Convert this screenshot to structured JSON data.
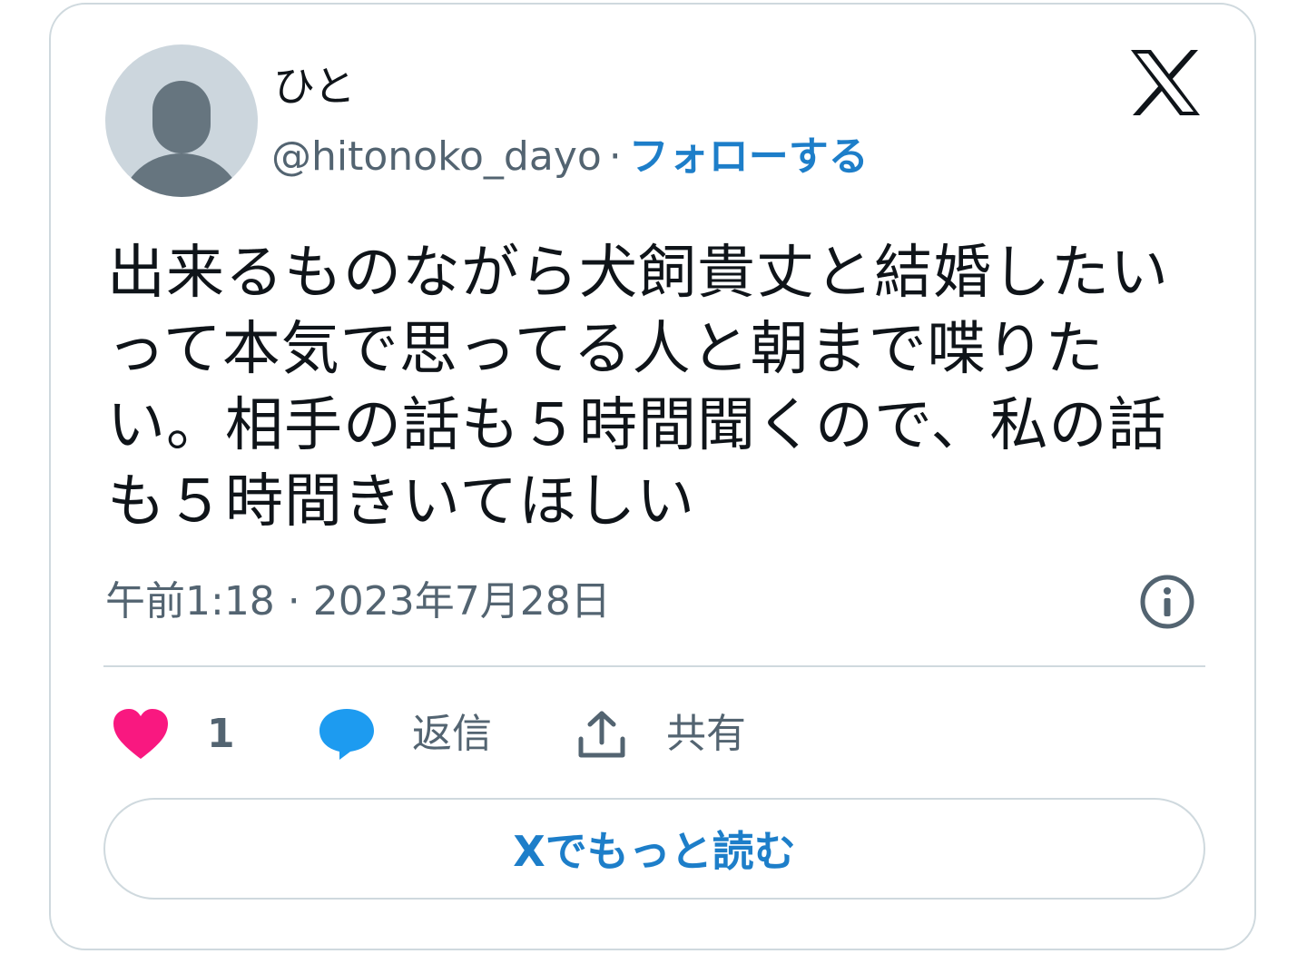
{
  "author": {
    "display_name": "ひと",
    "handle": "@hitonoko_dayo",
    "separator": "·",
    "follow_label": "フォローする"
  },
  "tweet": {
    "text": "出来るものながら犬飼貴丈と結婚したいって本気で思ってる人と朝まで喋りたい。相手の話も５時間聞くので、私の話も５時間きいてほしい",
    "timestamp": "午前1:18 · 2023年7月28日"
  },
  "actions": {
    "like_count": "1",
    "reply_label": "返信",
    "share_label": "共有"
  },
  "read_more_label": "Xでもっと読む",
  "colors": {
    "link_blue": "#1d7ec9",
    "like_pink": "#f91880",
    "reply_blue": "#1d9bf0",
    "secondary_text": "#536471",
    "border": "#cfd9de"
  },
  "icons": {
    "logo": "x-logo-icon",
    "info": "info-icon",
    "like": "heart-icon",
    "reply": "speech-bubble-icon",
    "share": "share-upload-icon"
  }
}
